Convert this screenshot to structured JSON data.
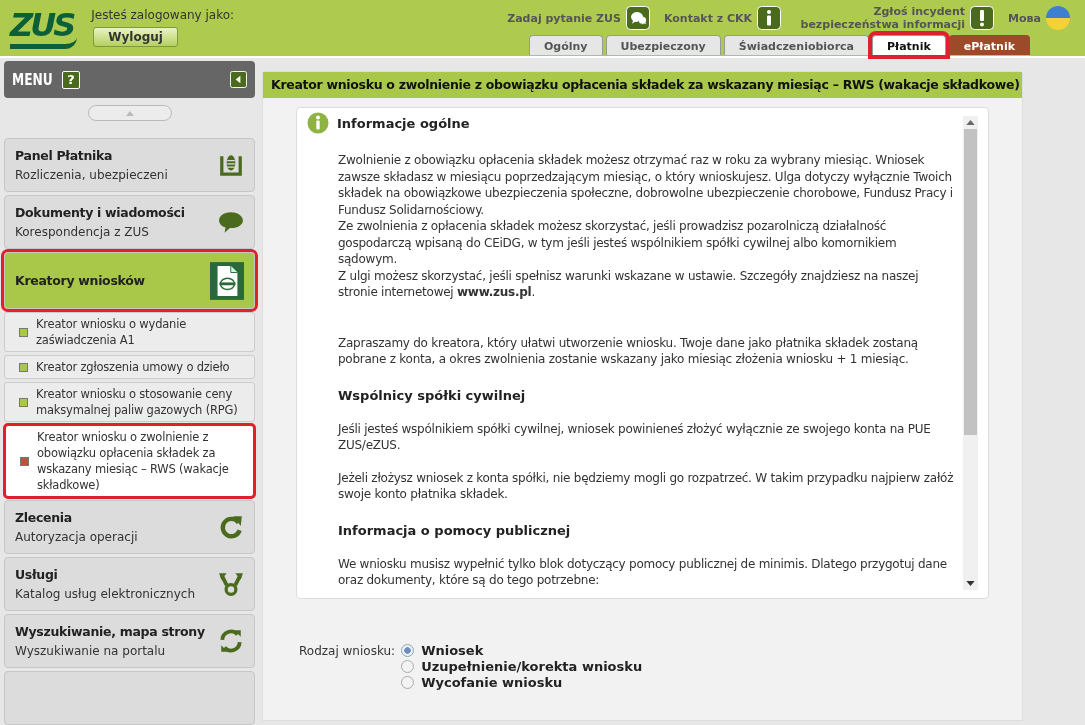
{
  "header": {
    "logo": "ZUS",
    "login_label": "Jesteś zalogowany jako:",
    "logout_button": "Wyloguj",
    "links": [
      {
        "label": "Zadaj pytanie ZUS",
        "kind": "chat"
      },
      {
        "label": "Kontakt z CKK",
        "kind": "info"
      },
      {
        "label": "Zgłoś incydent bezpieczeństwa informacji",
        "kind": "alert"
      }
    ],
    "language": "Мова",
    "tabs": [
      {
        "label": "Ogólny",
        "kind": "standard",
        "selected": false,
        "highlighted": false
      },
      {
        "label": "Ubezpieczony",
        "kind": "standard",
        "selected": false,
        "highlighted": false
      },
      {
        "label": "Świadczeniobiorca",
        "kind": "standard",
        "selected": false,
        "highlighted": false
      },
      {
        "label": "Płatnik",
        "kind": "standard",
        "selected": true,
        "highlighted": true
      },
      {
        "label": "ePłatnik",
        "kind": "external",
        "selected": false,
        "highlighted": false
      }
    ]
  },
  "sidebar": {
    "title": "MENU",
    "help": "?",
    "items": [
      {
        "title": "Panel Płatnika",
        "subtitle": "Rozliczenia, ubezpieczeni",
        "selected": false,
        "highlighted": false
      },
      {
        "title": "Dokumenty i wiadomości",
        "subtitle": "Korespondencja z ZUS",
        "selected": false,
        "highlighted": false
      },
      {
        "title": "Kreatory wniosków",
        "selected": true,
        "highlighted": true,
        "children": [
          {
            "label": "Kreator wniosku o wydanie zaświadczenia A1",
            "selected": false,
            "highlighted": false
          },
          {
            "label": "Kreator zgłoszenia umowy o dzieło",
            "selected": false,
            "highlighted": false
          },
          {
            "label": "Kreator wniosku o stosowanie ceny maksymalnej paliw gazowych (RPG)",
            "selected": false,
            "highlighted": false
          },
          {
            "label": "Kreator wniosku o zwolnienie z obowiązku opłacenia składek za wskazany miesiąc – RWS (wakacje składkowe)",
            "selected": true,
            "highlighted": true
          }
        ]
      },
      {
        "title": "Zlecenia",
        "subtitle": "Autoryzacja operacji",
        "selected": false,
        "highlighted": false
      },
      {
        "title": "Usługi",
        "subtitle": "Katalog usług elektronicznych",
        "selected": false,
        "highlighted": false
      },
      {
        "title": "Wyszukiwanie, mapa strony",
        "subtitle": "Wyszukiwanie na portalu",
        "selected": false,
        "highlighted": false
      },
      {
        "selected": false,
        "highlighted": false
      }
    ]
  },
  "main": {
    "title": "Kreator wniosku o zwolnienie z obowiązku opłacenia składek za wskazany miesiąc – RWS (wakacje składkowe)",
    "info_heading": "Informacje ogólne",
    "blocks": [
      {
        "kind": "paragraph",
        "lines": [
          "Zwolnienie z obowiązku opłacenia składek możesz otrzymać raz w roku za wybrany miesiąc. Wniosek zawsze składasz w miesiącu poprzedzającym miesiąc, o który wnioskujesz. Ulga dotyczy wyłącznie Twoich składek na obowiązkowe ubezpieczenia społeczne, dobrowolne ubezpieczenie chorobowe, Fundusz Pracy i Fundusz Solidarnościowy.",
          "Ze zwolnienia z opłacenia składek możesz skorzystać, jeśli prowadzisz pozarolniczą działalność gospodarczą wpisaną do CEiDG, w tym jeśli jesteś wspólnikiem spółki cywilnej albo komornikiem sądowym.",
          "Z ulgi możesz skorzystać, jeśli spełnisz warunki wskazane w ustawie. Szczegóły znajdziesz na naszej stronie internetowej **www.zus.pl**."
        ]
      },
      {
        "kind": "paragraph",
        "lines": [
          "Zapraszamy do kreatora, który ułatwi utworzenie wniosku. Twoje dane jako płatnika składek zostaną pobrane z konta, a okres zwolnienia zostanie wskazany jako miesiąc złożenia wniosku + 1 miesiąc."
        ]
      },
      {
        "kind": "heading",
        "lines": [
          "Wspólnicy spółki cywilnej"
        ]
      },
      {
        "kind": "paragraph",
        "lines": [
          "Jeśli jesteś wspólnikiem spółki cywilnej, wniosek powinieneś złożyć wyłącznie ze swojego konta na PUE ZUS/eZUS."
        ]
      },
      {
        "kind": "paragraph",
        "lines": [
          "Jeżeli złożysz wniosek z konta spółki, nie będziemy mogli go rozpatrzeć. W takim przypadku najpierw załóż swoje konto płatnika składek."
        ]
      },
      {
        "kind": "heading",
        "lines": [
          "Informacja o pomocy publicznej"
        ]
      },
      {
        "kind": "paragraph",
        "lines": [
          "We wniosku musisz wypełnić tylko blok dotyczący pomocy publicznej de minimis. Dlatego przygotuj dane oraz dokumenty, które są do tego potrzebne:"
        ]
      }
    ],
    "request_type": {
      "label": "Rodzaj wniosku:",
      "options": [
        {
          "label": "Wniosek",
          "selected": true
        },
        {
          "label": "Uzupełnienie/korekta wniosku",
          "selected": false
        },
        {
          "label": "Wycofanie wniosku",
          "selected": false
        }
      ]
    }
  }
}
